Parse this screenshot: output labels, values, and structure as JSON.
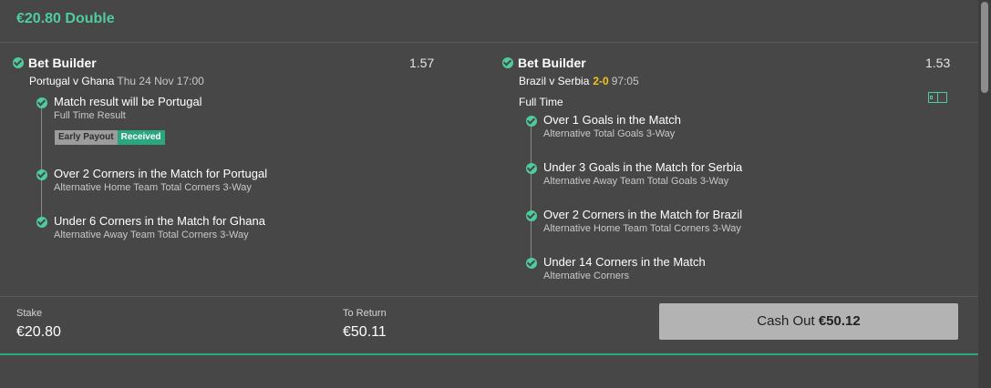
{
  "header": {
    "title": "€20.80 Double"
  },
  "left_leg": {
    "type": "Bet Builder",
    "odds": "1.57",
    "match": "Portugal v Ghana",
    "datetime": "Thu 24 Nov 17:00",
    "selections": [
      {
        "name": "Match result will be Portugal",
        "market": "Full Time Result"
      },
      {
        "name": "Over 2 Corners in the Match for Portugal",
        "market": "Alternative Home Team Total Corners 3-Way"
      },
      {
        "name": "Under 6 Corners in the Match for Ghana",
        "market": "Alternative Away Team Total Corners 3-Way"
      }
    ],
    "badges": {
      "early_payout": "Early Payout",
      "received": "Received"
    }
  },
  "right_leg": {
    "type": "Bet Builder",
    "odds": "1.53",
    "match": "Brazil v Serbia",
    "score": "2-0",
    "clock": "97:05",
    "period": "Full Time",
    "pitch_icon": "pitch-icon",
    "selections": [
      {
        "name": "Over 1 Goals in the Match",
        "market": "Alternative Total Goals 3-Way"
      },
      {
        "name": "Under 3 Goals in the Match for Serbia",
        "market": "Alternative Away Team Total Goals 3-Way"
      },
      {
        "name": "Over 2 Corners in the Match for Brazil",
        "market": "Alternative Home Team Total Corners 3-Way"
      },
      {
        "name": "Under 14 Corners in the Match",
        "market": "Alternative Corners"
      }
    ]
  },
  "footer": {
    "stake_label": "Stake",
    "stake_value": "€20.80",
    "return_label": "To Return",
    "return_value": "€50.11",
    "cashout_label": "Cash Out",
    "cashout_value": "€50.12"
  },
  "colors": {
    "background": "#474747",
    "accent": "#4ecc9e",
    "score": "#f5c518",
    "cashout_button": "#b3b3b3"
  }
}
